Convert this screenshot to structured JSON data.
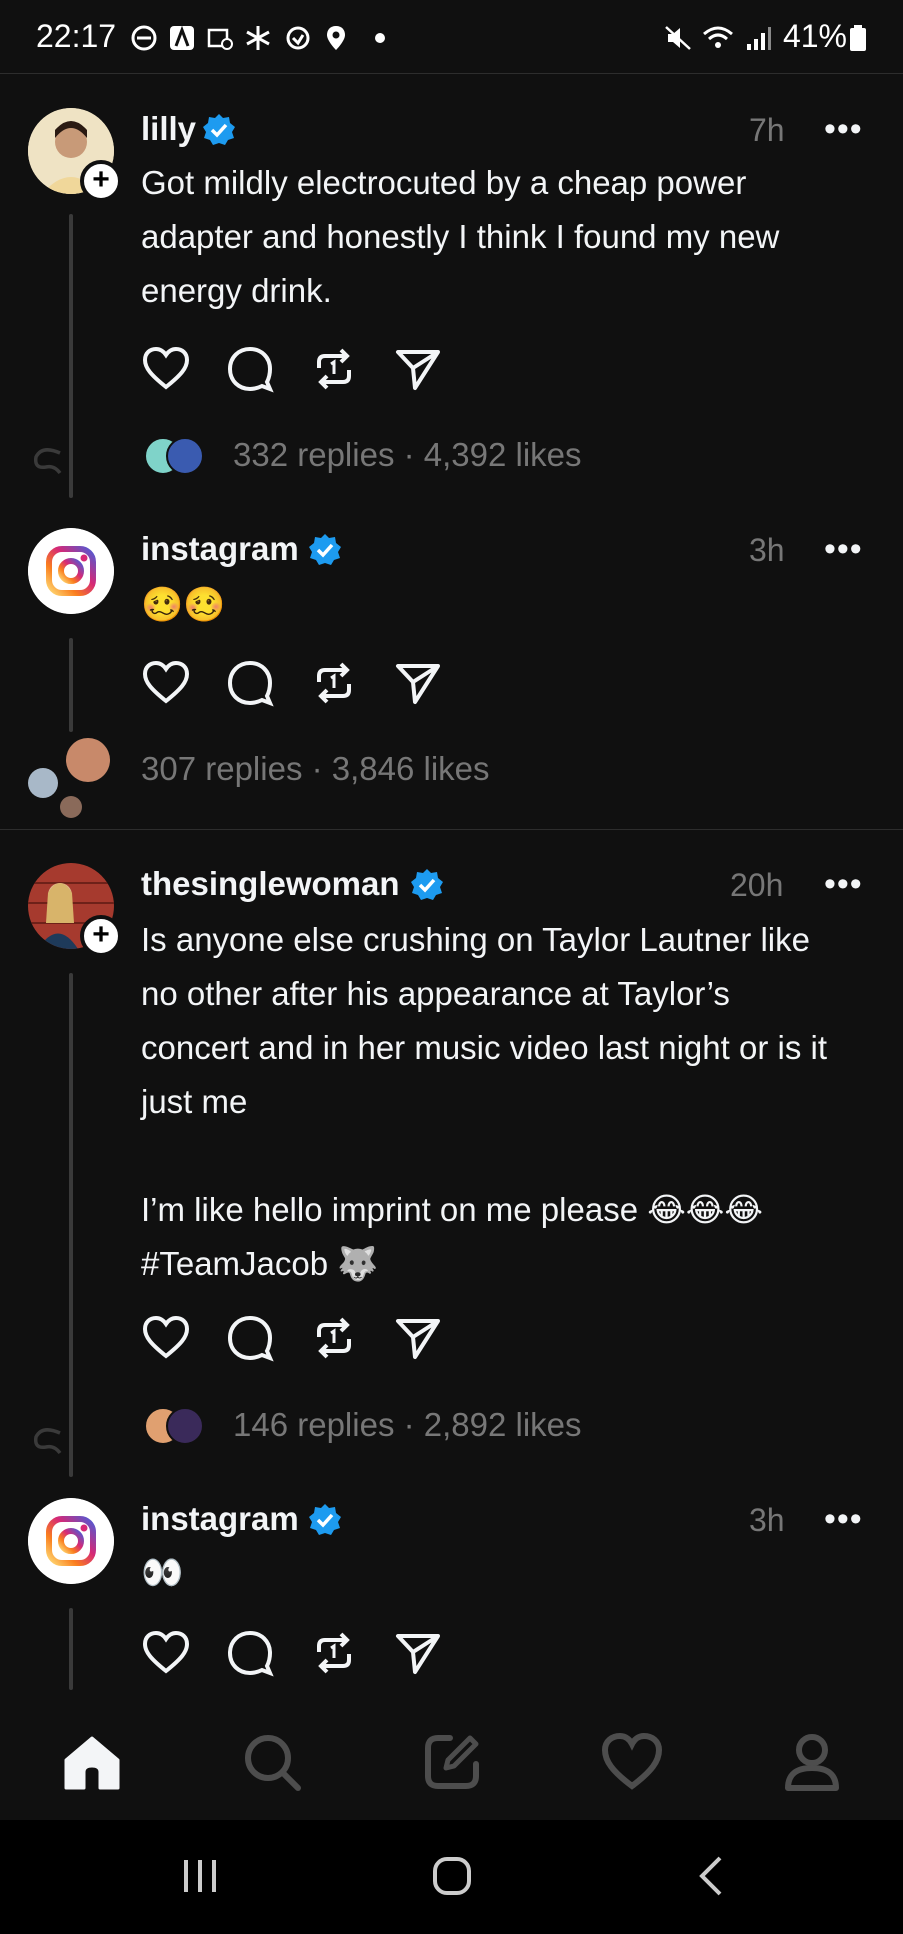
{
  "status_bar": {
    "time": "22:17",
    "battery": "41%"
  },
  "posts": [
    {
      "username": "lilly",
      "time": "7h",
      "text": "Got mildly electrocuted by a cheap power\nadapter and honestly I think I found my new\nenergy drink.",
      "stats": "332 replies · 4,392 likes"
    },
    {
      "username": "instagram",
      "time": "3h",
      "text": "🥴🥴",
      "stats": "307 replies · 3,846 likes"
    },
    {
      "username": "thesinglewoman",
      "time": "20h",
      "text": "Is anyone else crushing on Taylor Lautner like\nno other after his appearance at Taylor’s\nconcert and in her music video last night or is it\njust me\n\nI’m like hello imprint on me please 😂😂😂\n#TeamJacob 🐺",
      "stats": "146 replies · 2,892 likes"
    },
    {
      "username": "instagram",
      "time": "3h",
      "text": "👀",
      "stats": ""
    }
  ],
  "more_label": "•••",
  "colors": {
    "background": "#101010",
    "verified": "#1d9bf0",
    "muted": "#777777",
    "instagram_gradient": [
      "#feda75",
      "#fa7e1e",
      "#d62976",
      "#962fbf",
      "#4f5bd5"
    ]
  },
  "icons": {
    "actions": [
      "heart-icon",
      "comment-icon",
      "repost-icon",
      "share-icon"
    ],
    "bottom_nav": [
      "home-icon",
      "search-icon",
      "compose-icon",
      "activity-icon",
      "profile-icon"
    ],
    "system_nav": [
      "recents-icon",
      "home-circle-icon",
      "back-icon"
    ]
  }
}
